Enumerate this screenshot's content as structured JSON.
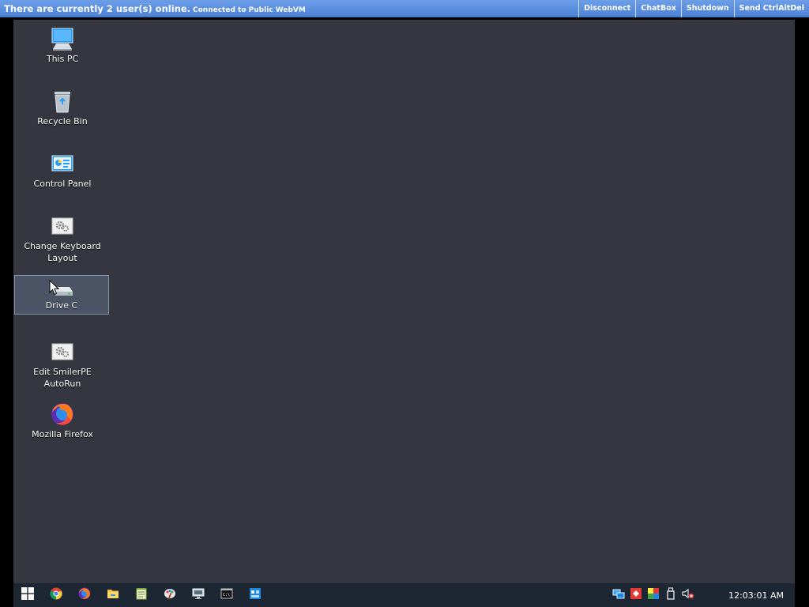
{
  "topbar": {
    "status_main": "There are currently 2 user(s) online.",
    "status_sub": "Connected to Public WebVM",
    "actions": [
      "Disconnect",
      "ChatBox",
      "Shutdown",
      "Send CtrlAltDel"
    ]
  },
  "desktop": {
    "background": "#343740",
    "icons": [
      {
        "label": "This PC",
        "icon": "computer-icon"
      },
      {
        "label": "Recycle Bin",
        "icon": "recycle-bin-icon"
      },
      {
        "label": "Control Panel",
        "icon": "control-panel-icon"
      },
      {
        "label": "Change Keyboard Layout",
        "icon": "settings-gear-icon"
      },
      {
        "label": "Drive C",
        "icon": "drive-icon",
        "selected": true
      },
      {
        "label": "Edit SmilerPE AutoRun",
        "icon": "settings-gear-icon"
      },
      {
        "label": "Mozilla Firefox",
        "icon": "firefox-icon"
      }
    ]
  },
  "taskbar": {
    "background": "#1d2733",
    "pinned": [
      "windows-start-icon",
      "chrome-icon",
      "firefox-icon",
      "file-explorer-icon",
      "notepad-icon",
      "paint-icon",
      "remote-desktop-icon",
      "command-prompt-icon",
      "app-icon"
    ],
    "tray": [
      "network-icon",
      "anydesk-icon",
      "color-icon",
      "usb-drive-icon",
      "volume-muted-icon"
    ],
    "clock": "12:03:01 AM"
  }
}
